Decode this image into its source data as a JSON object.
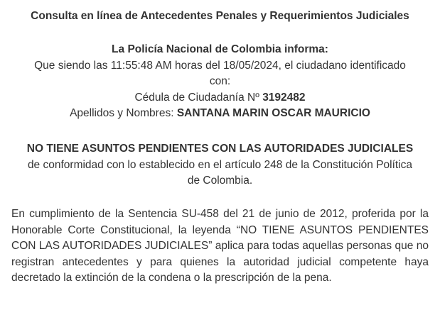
{
  "title": "Consulta en línea de Antecedentes Penales y Requerimientos Judiciales",
  "informa_heading": "La Policía Nacional de Colombia informa:",
  "line1": "Que siendo las 11:55:48 AM horas del 18/05/2024, el ciudadano identificado",
  "line2": "con:",
  "cedula_label": "Cédula de Ciudadanía Nº",
  "cedula_number": "3192482",
  "names_label": "Apellidos y Nombres:",
  "names_value": "SANTANA MARIN OSCAR MAURICIO",
  "status_heading": "NO TIENE ASUNTOS PENDIENTES CON LAS AUTORIDADES JUDICIALES",
  "status_line1": "de conformidad con lo establecido en el artículo 248 de la Constitución Política",
  "status_line2": "de Colombia.",
  "paragraph": "En cumplimiento de la Sentencia SU-458 del 21 de junio de 2012, proferida por la Honorable Corte Constitucional, la leyenda “NO TIENE ASUNTOS PENDIENTES CON LAS AUTORIDADES JUDICIALES” aplica para todas aquellas personas que no registran antecedentes y para quienes la autoridad judicial competente haya decretado la extinción de la condena o la prescripción de la pena."
}
